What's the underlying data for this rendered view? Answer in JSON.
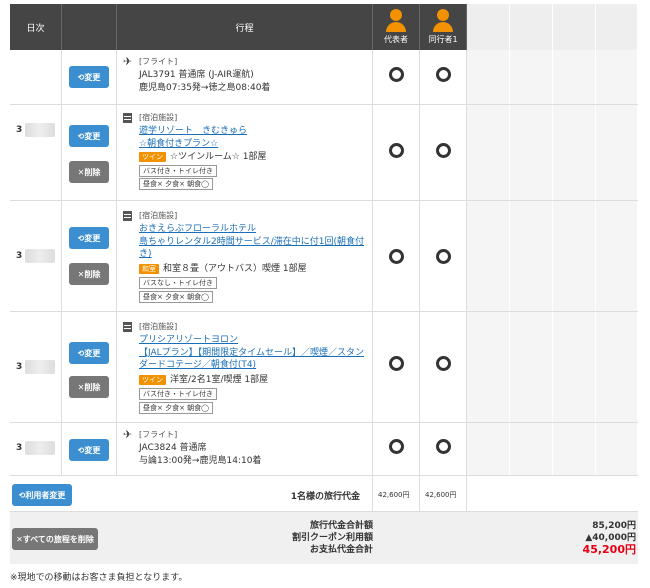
{
  "header": {
    "date": "日次",
    "itinerary": "行程",
    "rep": "代表者",
    "comp": "同行者1"
  },
  "buttons": {
    "change": "変更",
    "delete": "削除",
    "change_user": "利用者変更",
    "delete_all": "すべての旅程を削除"
  },
  "rows": [
    {
      "date_prefix": "",
      "category": "[フライト]",
      "line1": "JAL3791 普通席 (J-AIR運航)",
      "line2": "鹿児島07:35発→徳之島08:40着"
    },
    {
      "date_prefix": "3",
      "category": "[宿泊施設]",
      "name": "遊学リゾート　きむきゅら",
      "plan": "☆朝食付きプラン☆",
      "room_tag": "ツイン",
      "room": "☆ツインルーム☆ 1部屋",
      "bath": "バス付き・トイレ付き",
      "meals": "昼食×  夕食×  朝食◯"
    },
    {
      "date_prefix": "3",
      "category": "[宿泊施設]",
      "name": "おきえらぶフローラルホテル",
      "plan": "島ちゃりレンタル2時間サービス/滞在中に付1回(朝食付き)",
      "room_tag": "和室",
      "room": "和室８畳（アウトバス）喫煙 1部屋",
      "bath": "バスなし・トイレ付き",
      "meals": "昼食×  夕食×  朝食◯"
    },
    {
      "date_prefix": "3",
      "category": "[宿泊施設]",
      "name": "プリシアリゾートヨロン",
      "plan": "【JALプラン】【期間限定タイムセール】／喫煙／スタンダードコテージ／朝食付(T4)",
      "room_tag": "ツイン",
      "room": "洋室/2名1室/喫煙 1部屋",
      "bath": "バス付き・トイレ付き",
      "meals": "昼食×  夕食×  朝食◯"
    },
    {
      "date_prefix": "3",
      "category": "[フライト]",
      "line1": "JAC3824 普通席",
      "line2": "与論13:00発→鹿児島14:10着"
    }
  ],
  "totals": {
    "per_person_label": "1名様の旅行代金",
    "rep_price": "42,600円",
    "comp_price": "42,600円",
    "total_label": "旅行代金合計額",
    "coupon_label": "割引クーポン利用額",
    "pay_label": "お支払代金合計",
    "total": "85,200円",
    "coupon": "▲40,000円",
    "pay": "45,200円"
  },
  "note": "※現地での移動はお客さま負担となります。",
  "colors": {
    "accent": "#f39200",
    "button": "#3b8fd0",
    "header": "#454545",
    "price_red": "#e60012"
  }
}
